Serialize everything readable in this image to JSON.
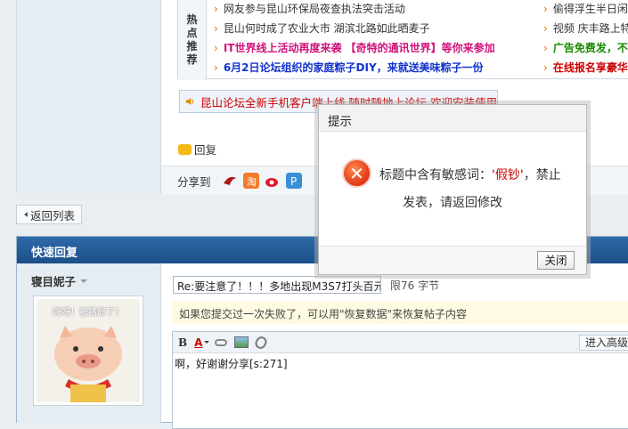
{
  "hot": {
    "label_chars": [
      "热",
      "点",
      "推",
      "荐"
    ],
    "left_items": [
      {
        "text": "网友参与昆山环保局夜查执法突击活动",
        "style": "normal"
      },
      {
        "text": "昆山何时成了农业大市 湖滨北路如此晒麦子",
        "style": "normal"
      },
      {
        "text": "IT世界线上活动再度来袭 【奇特的通讯世界】等你来参加",
        "style": "pink"
      },
      {
        "text": "6月2日论坛组织的家庭粽子DIY，来就送美味粽子一份",
        "style": "blue"
      }
    ],
    "right_items": [
      {
        "text": "偷得浮生半日闲",
        "style": "normal"
      },
      {
        "text": "视频 庆丰路上特",
        "style": "normal"
      },
      {
        "text": "广告免费发，不",
        "style": "green"
      },
      {
        "text": "在线报名享豪华",
        "style": "red"
      }
    ]
  },
  "notice": {
    "text": "昆山论坛全新手机客户端上线 随时随地上论坛 欢迎安装使用"
  },
  "reply": {
    "label": "回复"
  },
  "share": {
    "label": "分享到"
  },
  "back": {
    "label": "返回列表"
  },
  "quick_reply": {
    "header": "快速回复",
    "username": "寝目妮子",
    "avatar_caption": "嗨呀！被猪郎了！",
    "title_value": "Re:要注意了！！！多地出现M3S7打头百元",
    "title_limit": "限76 字节",
    "recover_tip": "如果您提交过一次失败了，可以用\"恢复数据\"来恢复帖子内容",
    "editor_content": "啊，好谢谢分享[s:271]",
    "advanced_label": "进入高级模",
    "toolbar": {
      "bold": "B",
      "color": "A"
    }
  },
  "modal": {
    "title": "提示",
    "message_prefix": "标题中含有敏感词：",
    "sensitive_word": "'假钞'",
    "message_suffix": "，禁止",
    "message_line2": "发表，请返回修改",
    "close_label": "关闭",
    "error_glyph": "✕"
  },
  "colors": {
    "header_blue": "#1c4f8a",
    "error_red": "#e2361a",
    "notice_red": "#cc0000"
  }
}
